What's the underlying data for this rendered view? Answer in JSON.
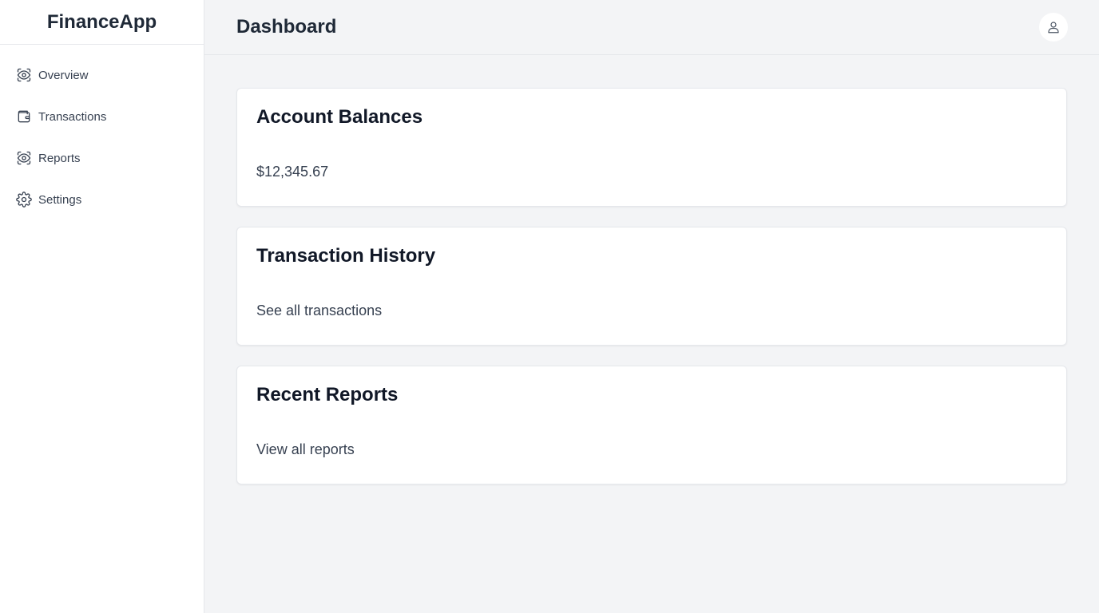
{
  "app": {
    "brand": "FinanceApp"
  },
  "sidebar": {
    "items": [
      {
        "label": "Overview",
        "icon": "eye-icon"
      },
      {
        "label": "Transactions",
        "icon": "wallet-icon"
      },
      {
        "label": "Reports",
        "icon": "eye-icon"
      },
      {
        "label": "Settings",
        "icon": "gear-icon"
      }
    ]
  },
  "header": {
    "title": "Dashboard",
    "avatar_icon": "user-icon"
  },
  "cards": [
    {
      "title": "Account Balances",
      "body": "$12,345.67"
    },
    {
      "title": "Transaction History",
      "body": "See all transactions"
    },
    {
      "title": "Recent Reports",
      "body": "View all reports"
    }
  ],
  "colors": {
    "background": "#f3f4f6",
    "sidebar": "#ffffff",
    "text": "#1f2937",
    "border": "#e5e7eb"
  }
}
